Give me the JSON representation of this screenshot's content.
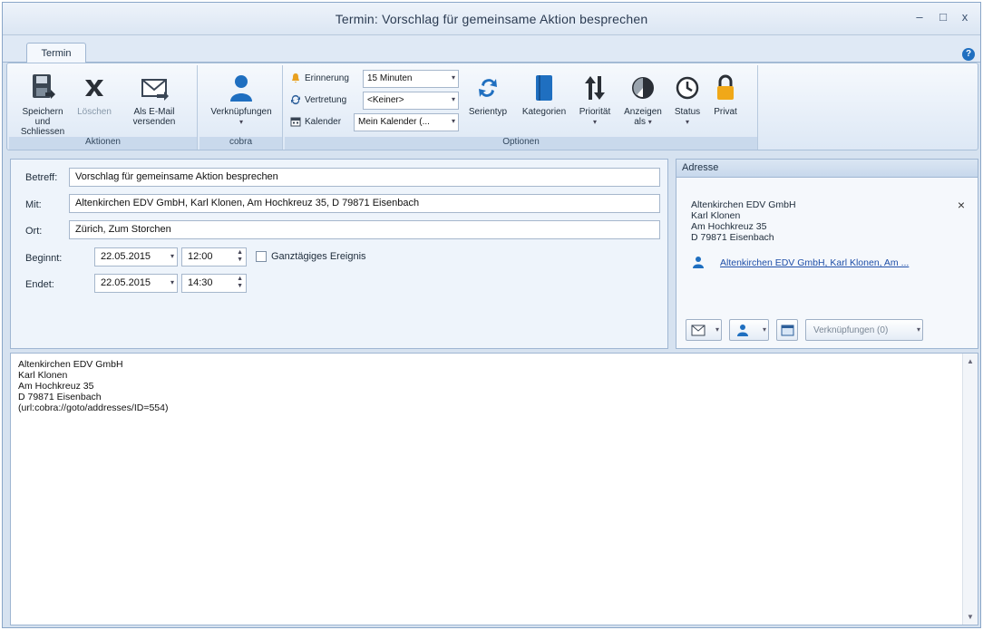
{
  "window": {
    "title": "Termin: Vorschlag für gemeinsame Aktion besprechen",
    "minimize": "–",
    "maximize": "□",
    "close": "x"
  },
  "tabs": [
    {
      "label": "Termin"
    }
  ],
  "ribbon": {
    "aktionen": {
      "label": "Aktionen",
      "save": "Speichern und Schliessen",
      "delete": "Löschen",
      "email": "Als E-Mail versenden"
    },
    "cobra": {
      "label": "cobra",
      "links": "Verknüpfungen"
    },
    "optionen": {
      "label": "Optionen",
      "reminder_label": "Erinnerung",
      "reminder_value": "15 Minuten",
      "substitute_label": "Vertretung",
      "substitute_value": "<Keiner>",
      "calendar_label": "Kalender",
      "calendar_value": "Mein Kalender (...",
      "series": "Serientyp",
      "categories": "Kategorien",
      "priority": "Priorität",
      "show_as": "Anzeigen als",
      "status": "Status",
      "private": "Privat"
    }
  },
  "form": {
    "subject_label": "Betreff:",
    "subject_value": "Vorschlag für gemeinsame Aktion besprechen",
    "with_label": "Mit:",
    "with_value": "Altenkirchen EDV GmbH, Karl Klonen, Am Hochkreuz 35, D 79871 Eisenbach",
    "location_label": "Ort:",
    "location_value": "Zürich, Zum Storchen",
    "start_label": "Beginnt:",
    "start_date": "22.05.2015",
    "start_time": "12:00",
    "allday_label": "Ganztägiges Ereignis",
    "end_label": "Endet:",
    "end_date": "22.05.2015",
    "end_time": "14:30"
  },
  "address": {
    "header": "Adresse",
    "lines": [
      "Altenkirchen EDV GmbH",
      "Karl Klonen",
      "Am Hochkreuz 35",
      "D 79871 Eisenbach"
    ],
    "link": "Altenkirchen EDV GmbH, Karl Klonen, Am ...",
    "links_button": "Verknüpfungen (0)",
    "remove": "×"
  },
  "notes": {
    "lines": [
      "Altenkirchen EDV GmbH",
      "Karl Klonen",
      "Am Hochkreuz 35",
      "D 79871 Eisenbach",
      "(url:cobra://goto/addresses/ID=554)"
    ]
  },
  "colors": {
    "accent": "#1f6fc0",
    "link": "#1f4fa8",
    "panel": "#eef4fb",
    "bell": "#e8a020",
    "lock": "#f0a818"
  }
}
